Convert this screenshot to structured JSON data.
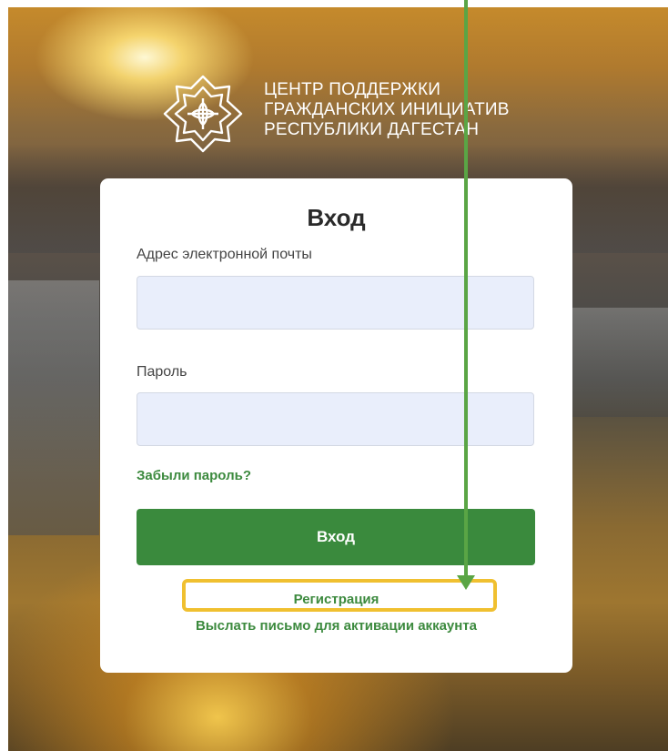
{
  "org": {
    "line1": "ЦЕНТР ПОДДЕРЖКИ",
    "line2": "ГРАЖДАНСКИХ ИНИЦИАТИВ",
    "line3": "РЕСПУБЛИКИ ДАГЕСТАН",
    "logo_icon": "ornament-logo-icon"
  },
  "login": {
    "title": "Вход",
    "email_label": "Адрес электронной почты",
    "email_value": "",
    "password_label": "Пароль",
    "password_value": "",
    "forgot_link": "Забыли пароль?",
    "submit_label": "Вход",
    "register_link": "Регистрация",
    "activation_link": "Выслать письмо для активации аккаунта"
  },
  "annotation": {
    "arrow_icon": "arrow-down-icon",
    "highlight_color": "#f0c030",
    "arrow_color": "#5aa545"
  },
  "colors": {
    "accent_green": "#3a8a3d",
    "link_green": "#3c8a3e",
    "input_bg": "#e9eefb"
  }
}
